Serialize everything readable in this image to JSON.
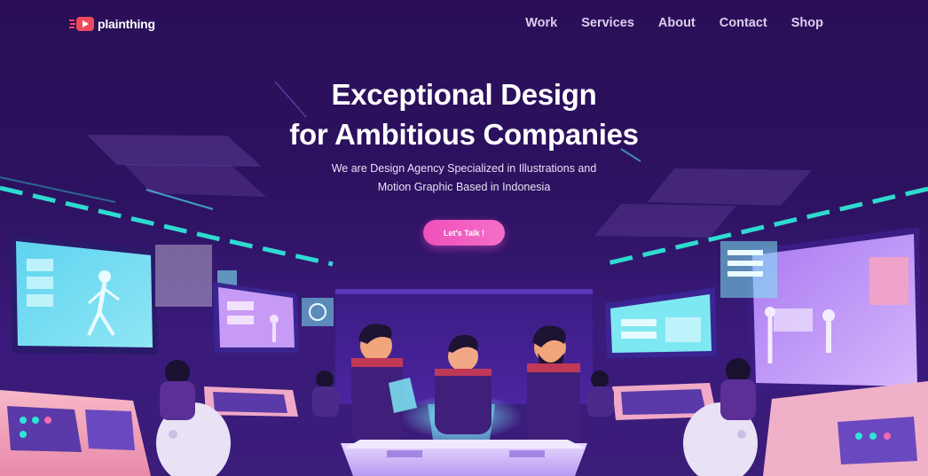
{
  "brand": {
    "name": "plainthing",
    "accent": "#f04a5d"
  },
  "nav": {
    "items": [
      {
        "label": "Work"
      },
      {
        "label": "Services"
      },
      {
        "label": "About"
      },
      {
        "label": "Contact"
      },
      {
        "label": "Shop"
      }
    ]
  },
  "hero": {
    "title_line1": "Exceptional Design",
    "title_line2": "for Ambitious Companies",
    "subtitle_line1": "We are Design Agency Specialized in Illustrations and",
    "subtitle_line2": "Motion Graphic Based in Indonesia",
    "cta_label": "Let's Talk !"
  },
  "colors": {
    "background": "#2a0f57",
    "cta_gradient_start": "#ef4fb9",
    "cta_gradient_end": "#f46fc9",
    "neon_teal": "#2ee6d6",
    "screen_cyan": "#7ee8f2",
    "screen_violet": "#b98af5"
  },
  "illustration": {
    "subject": "futuristic control room with designers"
  }
}
